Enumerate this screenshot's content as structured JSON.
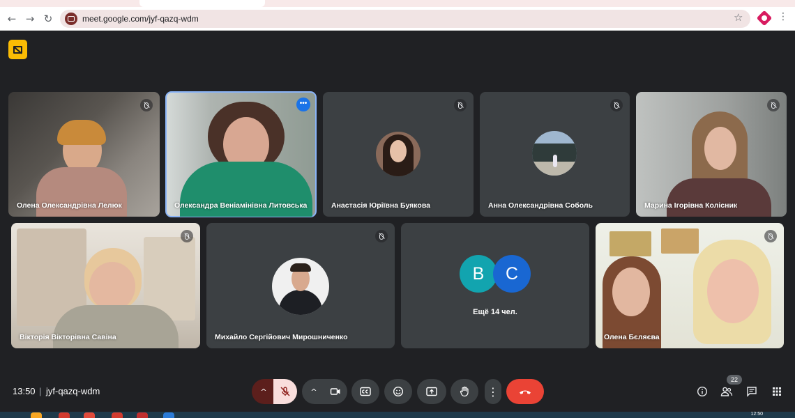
{
  "browser": {
    "url": "meet.google.com/jyf-qazq-wdm",
    "back_icon": "←",
    "forward_icon": "→",
    "reload_icon": "↻",
    "star_icon": "☆",
    "menu_icon": "⋮"
  },
  "tiles": {
    "t1": {
      "name": "Олена Олександрівна Лелюк"
    },
    "t2": {
      "name": "Олександра Веніамінівна Литовська",
      "more": "•••"
    },
    "t3": {
      "name": "Анастасія Юріївна Буякова"
    },
    "t4": {
      "name": "Анна Олександрівна Соболь"
    },
    "t5": {
      "name": "Марина Ігорівна Колісник"
    },
    "t6": {
      "name": "Вікторія Вікторівна Савіна"
    },
    "t7": {
      "name": "Михайло Сергійович Мирошниченко"
    },
    "t8": {
      "letter1": "B",
      "letter2": "C",
      "others": "Ещё 14 чел."
    },
    "t9": {
      "name": "Олена Бєляєва"
    }
  },
  "bottom": {
    "time": "13:50",
    "separator": "|",
    "meeting_code": "jyf-qazq-wdm",
    "participants_count": "22",
    "caret_up": "^",
    "more_options": "⋮"
  },
  "colors": {
    "background": "#202124",
    "tile": "#3c4043",
    "hangup": "#ea4335",
    "active_outline": "#8ab4f8",
    "avatar_b": "#12a4af",
    "avatar_c": "#1967d2"
  },
  "taskbar": {
    "time": "12:50"
  }
}
